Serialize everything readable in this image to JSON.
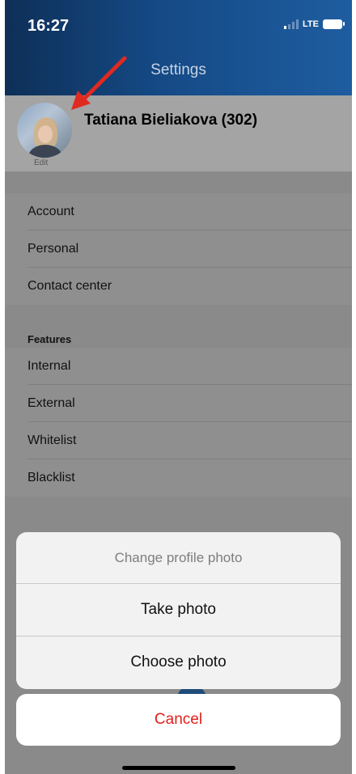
{
  "status_bar": {
    "time": "16:27",
    "network": "LTE"
  },
  "nav": {
    "title": "Settings"
  },
  "profile": {
    "name": "Tatiana Bieliakova (302)",
    "edit_label": "Edit"
  },
  "settings_rows": [
    {
      "label": "Account"
    },
    {
      "label": "Personal"
    },
    {
      "label": "Contact center"
    }
  ],
  "features": {
    "header": "Features",
    "rows": [
      {
        "label": "Internal"
      },
      {
        "label": "External"
      },
      {
        "label": "Whitelist"
      },
      {
        "label": "Blacklist"
      }
    ]
  },
  "action_sheet": {
    "title": "Change profile photo",
    "take_photo": "Take photo",
    "choose_photo": "Choose photo",
    "cancel": "Cancel"
  },
  "colors": {
    "header": "#154a86",
    "cancel": "#e0201b",
    "annotation_arrow": "#e02a1f"
  }
}
